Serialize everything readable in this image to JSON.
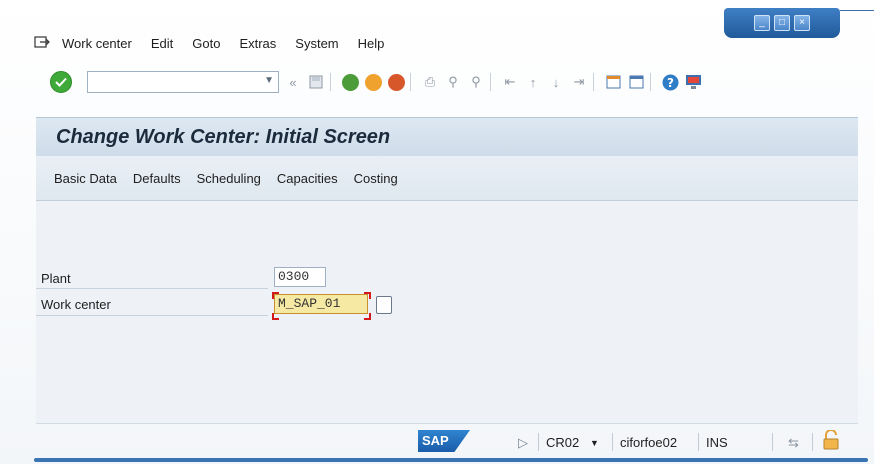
{
  "menu": {
    "items": [
      "Work center",
      "Edit",
      "Goto",
      "Extras",
      "System",
      "Help"
    ]
  },
  "toolbar": {
    "command_field_value": "",
    "icons": [
      "enter-icon",
      "command-field",
      "back-arrows-icon",
      "save-icon",
      "back-icon",
      "exit-icon",
      "cancel-icon",
      "print-icon",
      "find-icon",
      "find-next-icon",
      "first-page-icon",
      "previous-page-icon",
      "next-page-icon",
      "last-page-icon",
      "create-session-icon",
      "shortcut-icon",
      "help-icon",
      "customize-layout-icon"
    ]
  },
  "screen": {
    "title": "Change Work Center: Initial Screen"
  },
  "app_toolbar": {
    "buttons": [
      "Basic Data",
      "Defaults",
      "Scheduling",
      "Capacities",
      "Costing"
    ]
  },
  "form": {
    "plant_label": "Plant",
    "plant_value": "0300",
    "work_center_label": "Work center",
    "work_center_value": "M_SAP_01"
  },
  "status": {
    "logo": "SAP",
    "transaction": "CR02",
    "server": "ciforfoe02",
    "mode": "INS"
  },
  "colors": {
    "accent": "#3a74b2",
    "title_bar": "#d6e3ee",
    "active_field": "#f6e9a4"
  }
}
